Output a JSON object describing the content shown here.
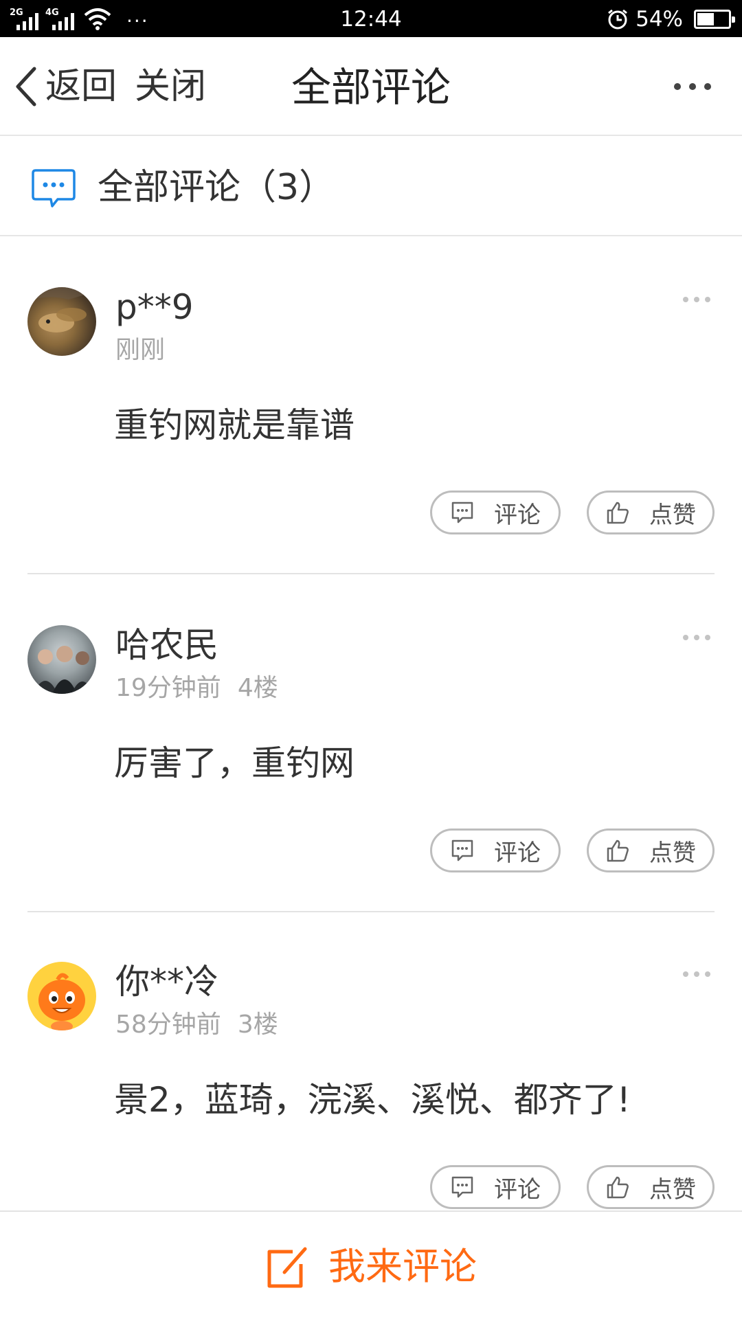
{
  "status_bar": {
    "network_1": "2G",
    "network_2": "4G",
    "overflow": "···",
    "time": "12:44",
    "battery_percent": "54%",
    "battery_level": 0.54,
    "icons": [
      "signal-icon",
      "wifi-icon",
      "alarm-icon",
      "battery-icon"
    ]
  },
  "nav": {
    "back_label": "返回",
    "close_label": "关闭",
    "title": "全部评论"
  },
  "section": {
    "title": "全部评论（3）",
    "accent_color": "#1e88e5"
  },
  "comments": [
    {
      "username": "p**9",
      "time": "刚刚",
      "floor": "",
      "content": "重钓网就是靠谱",
      "reply_label": "评论",
      "like_label": "点赞"
    },
    {
      "username": "哈农民",
      "time": "19分钟前",
      "floor": "4楼",
      "content": "厉害了，重钓网",
      "reply_label": "评论",
      "like_label": "点赞"
    },
    {
      "username": "你**冷",
      "time": "58分钟前",
      "floor": "3楼",
      "content": "景2，蓝琦，浣溪、溪悦、都齐了!",
      "reply_label": "评论",
      "like_label": "点赞"
    }
  ],
  "bottom_bar": {
    "write_label": "我来评论",
    "accent_color": "#ff6a13"
  }
}
